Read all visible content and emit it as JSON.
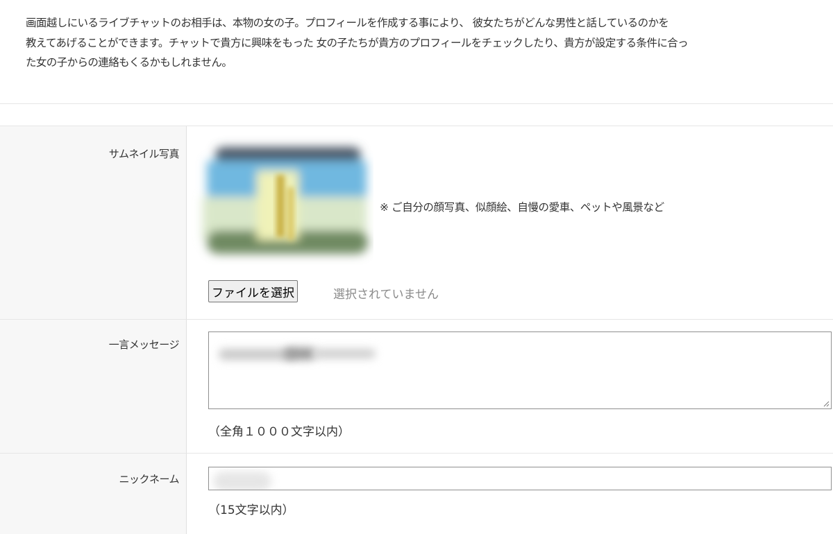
{
  "intro": {
    "line1": "画面越しにいるライブチャットのお相手は、本物の女の子。プロフィールを作成する事により、 彼女たちがどんな男性と話しているのかを",
    "line2": "教えてあげることができます。チャットで貴方に興味をもった 女の子たちが貴方のプロフィールをチェックしたり、貴方が設定する条件に合っ",
    "line3": "た女の子からの連絡もくるかもしれません。"
  },
  "form": {
    "thumbnail": {
      "label": "サムネイル写真",
      "note": "※ ご自分の顔写真、似顔絵、自慢の愛車、ペットや風景など",
      "file_button": "ファイルを選択",
      "file_status": "選択されていません"
    },
    "message": {
      "label": "一言メッセージ",
      "hint": "（全角１０００文字以内）"
    },
    "nickname": {
      "label": "ニックネーム",
      "hint": "（15文字以内）"
    }
  },
  "colors": {
    "label_bg": "#f7f7f7",
    "border": "#e0e0e0",
    "text": "#333333",
    "placeholder_gray": "#8a8a8a"
  }
}
